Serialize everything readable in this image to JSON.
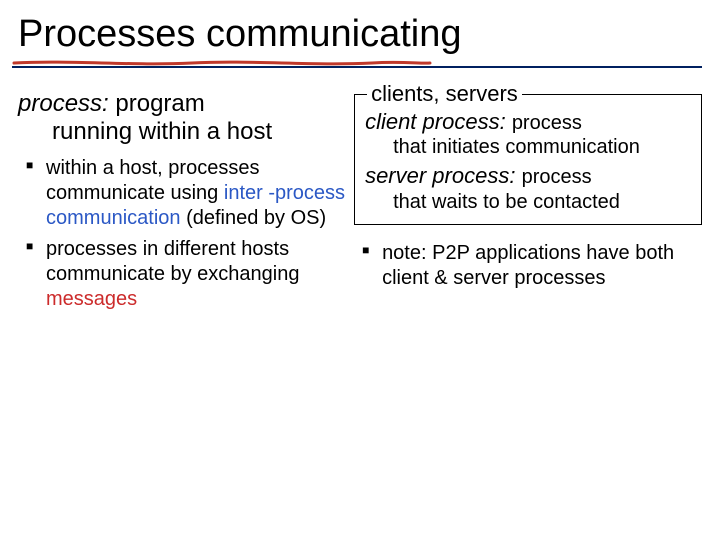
{
  "title": "Processes communicating",
  "left": {
    "def_term": "process:",
    "def_rest": "program",
    "def_line2": "running within a host",
    "b1_a": "within a host, processes communicate using ",
    "b1_blue": "inter -process communication",
    "b1_c": " (defined by OS)",
    "b2_a": "processes in different hosts communicate by exchanging ",
    "b2_red": "messages"
  },
  "right": {
    "box_title": "clients, servers",
    "client_term": "client process:",
    "client_trail": "process",
    "client_body": "that initiates communication",
    "server_term": "server process:",
    "server_trail": "process",
    "server_body": "that waits to be contacted",
    "note": "note: P2P applications have both client & server processes"
  }
}
